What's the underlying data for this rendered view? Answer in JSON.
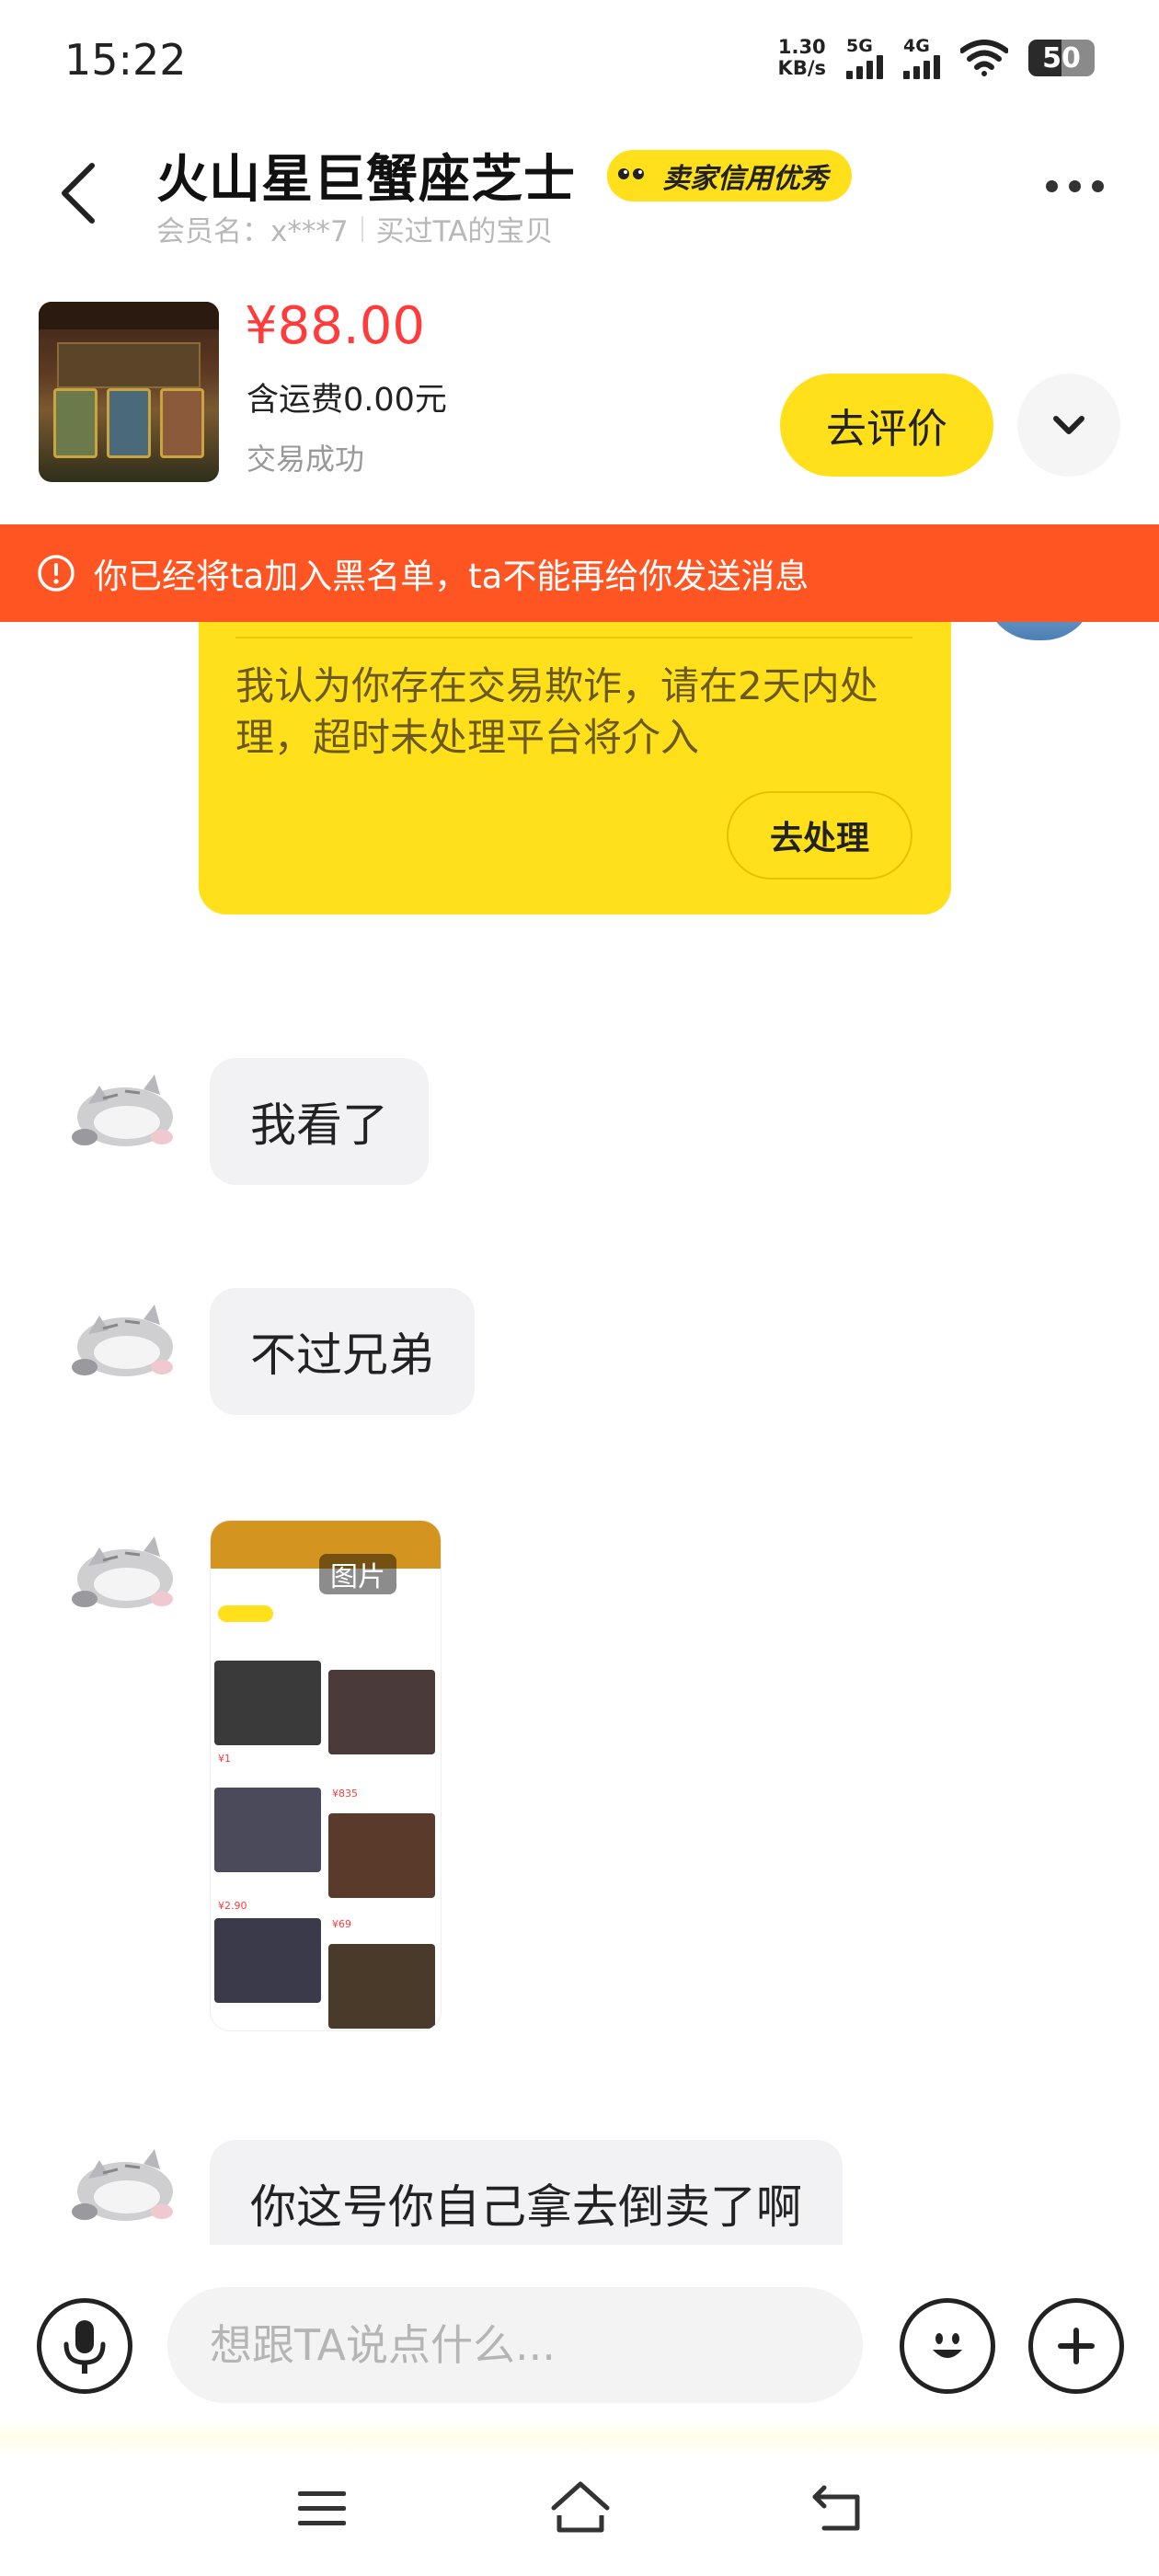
{
  "status_bar": {
    "time": "15:22",
    "net_speed_value": "1.30",
    "net_speed_unit": "KB/s",
    "signal1_label": "5G",
    "signal2_label": "4G",
    "battery_level": "50"
  },
  "header": {
    "shop_name": "火山星巨蟹座芝士",
    "credit_badge": "卖家信用优秀",
    "member_name": "会员名：x***7",
    "bought_info": "买过TA的宝贝"
  },
  "product": {
    "price": "¥88.00",
    "shipping": "含运费0.00元",
    "status": "交易成功",
    "review_button": "去评价"
  },
  "banner": {
    "text": "你已经将ta加入黑名单，ta不能再给你发送消息"
  },
  "dispute": {
    "text": "我认为你存在交易欺诈，请在2天内处理，超时未处理平台将介入",
    "button": "去处理"
  },
  "messages": [
    {
      "text": "我看了"
    },
    {
      "text": "不过兄弟"
    },
    {
      "image_label": "图片"
    },
    {
      "text": "你这号你自己拿去倒卖了啊"
    }
  ],
  "input": {
    "placeholder": "想跟TA说点什么..."
  },
  "colors": {
    "accent_yellow": "#ffe01a",
    "banner_orange": "#ff5523",
    "price_red": "#ff3b3b"
  }
}
